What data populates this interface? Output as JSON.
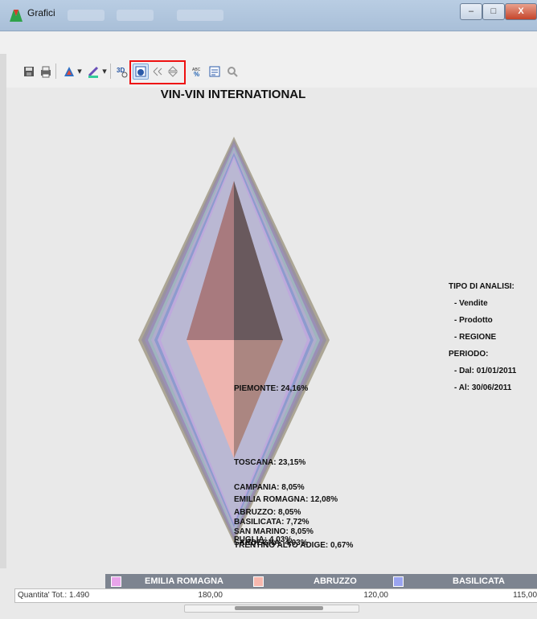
{
  "window": {
    "title": "Grafici",
    "minimize": "–",
    "maximize": "□",
    "close": "X"
  },
  "toolbar": {
    "icons": [
      "save-icon",
      "print-icon",
      "chart-type-icon",
      "color-icon",
      "3d-icon",
      "rotate-icon",
      "rotate-left-icon",
      "rotate-right-icon",
      "labels-icon",
      "legend-icon",
      "zoom-icon"
    ]
  },
  "chart_data": {
    "type": "pie",
    "title": "VIN-VIN INTERNATIONAL",
    "slices": [
      {
        "label": "PIEMONTE: 24,16%",
        "value": 24.16
      },
      {
        "label": "TOSCANA: 23,15%",
        "value": 23.15
      },
      {
        "label": "CAMPANIA: 8,05%",
        "value": 8.05
      },
      {
        "label": "EMILIA ROMAGNA: 12,08%",
        "value": 12.08
      },
      {
        "label": "ABRUZZO: 8,05%",
        "value": 8.05
      },
      {
        "label": "BASILICATA: 7,72%",
        "value": 7.72
      },
      {
        "label": "SAN MARINO: 8,05%",
        "value": 8.05
      },
      {
        "label": "PUGLIA: 4,03%",
        "value": 4.03
      },
      {
        "label": "SARDEGNA: 4,03%",
        "value": 4.03
      },
      {
        "label": "TRENTINO ALTO ADIGE: 0,67%",
        "value": 0.67
      }
    ],
    "colors": [
      "#f7b3a8",
      "#c3d5d8",
      "#f1d17a",
      "#e8a4ea",
      "#f8b8ae",
      "#9aa4f0",
      "#94d7a0",
      "#7fb2ea",
      "#b8d8b4",
      "#d8c89a"
    ]
  },
  "info": {
    "tipo": "TIPO DI ANALISI:",
    "vendite": "- Vendite",
    "prodotto": "- Prodotto",
    "regione": "- REGIONE",
    "periodo": "PERIODO:",
    "dal": "- Dal: 01/01/2011",
    "al": "- Al:  30/06/2011"
  },
  "legend": [
    {
      "label": "EMILIA ROMAGNA",
      "color": "#e8a4ea"
    },
    {
      "label": "ABRUZZO",
      "color": "#f8b8ae"
    },
    {
      "label": "BASILICATA",
      "color": "#9aa4f0"
    }
  ],
  "table": {
    "row_label": "Quantita' Tot.: 1.490",
    "values": [
      "180,00",
      "120,00",
      "115,00"
    ]
  }
}
